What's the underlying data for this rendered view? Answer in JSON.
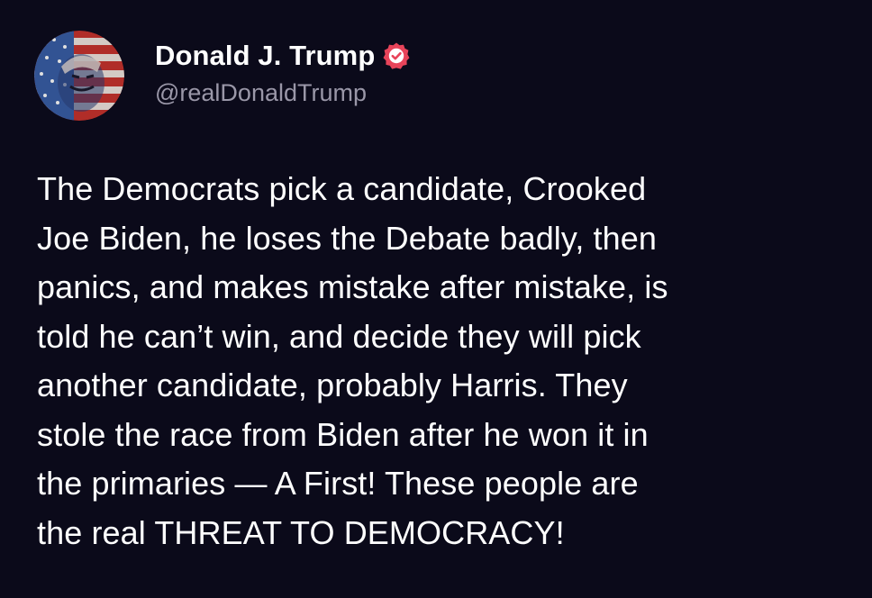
{
  "colors": {
    "background": "#0b0a1a",
    "text": "#ffffff",
    "handle": "#9a97a8",
    "badge": "#e8445a"
  },
  "author": {
    "display_name": "Donald J. Trump",
    "handle": "@realDonaldTrump",
    "verified_icon": "verified-badge-icon",
    "avatar_icon": "flag-painted-portrait"
  },
  "post": {
    "lines": [
      "The Democrats pick a candidate, Crooked",
      "Joe Biden, he loses the Debate badly, then",
      "panics, and makes mistake after mistake, is",
      "told he can’t win, and decide they will pick",
      "another candidate, probably Harris. They",
      "stole the race from Biden after he won it in",
      "the primaries — A First! These people are",
      "the real THREAT TO DEMOCRACY!"
    ]
  }
}
